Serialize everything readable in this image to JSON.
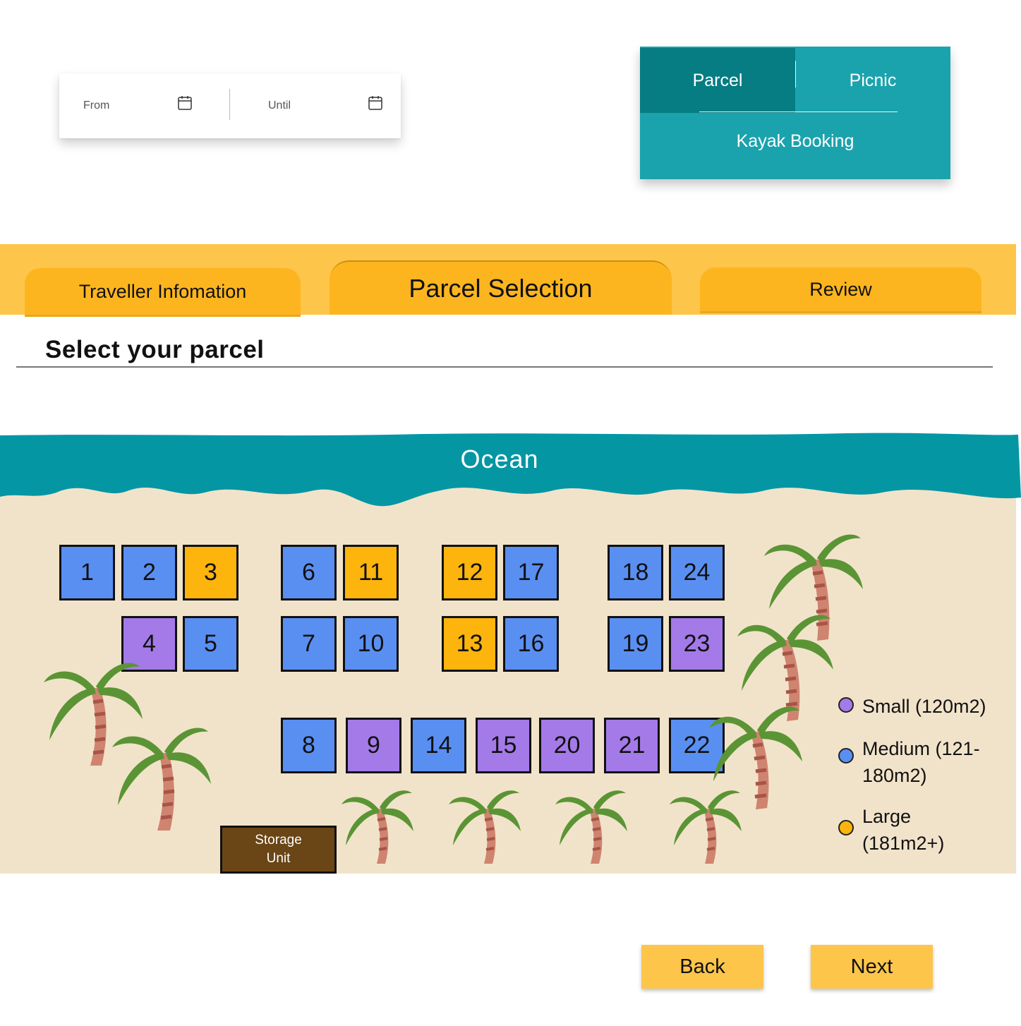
{
  "date_range": {
    "from_label": "From",
    "until_label": "Until"
  },
  "booking_types": {
    "parcel": "Parcel",
    "picnic": "Picnic",
    "kayak": "Kayak Booking",
    "active": "Parcel"
  },
  "steps": [
    "Traveller Infomation",
    "Parcel Selection",
    "Review"
  ],
  "active_step": "Parcel Selection",
  "section_title": "Select your parcel",
  "map": {
    "ocean_label": "Ocean",
    "storage_label_line1": "Storage",
    "storage_label_line2": "Unit",
    "parcels": [
      {
        "id": "1",
        "size": "medium"
      },
      {
        "id": "2",
        "size": "medium"
      },
      {
        "id": "3",
        "size": "large"
      },
      {
        "id": "4",
        "size": "small"
      },
      {
        "id": "5",
        "size": "medium"
      },
      {
        "id": "6",
        "size": "medium"
      },
      {
        "id": "11",
        "size": "large"
      },
      {
        "id": "7",
        "size": "medium"
      },
      {
        "id": "10",
        "size": "medium"
      },
      {
        "id": "12",
        "size": "large"
      },
      {
        "id": "17",
        "size": "medium"
      },
      {
        "id": "13",
        "size": "large"
      },
      {
        "id": "16",
        "size": "medium"
      },
      {
        "id": "18",
        "size": "medium"
      },
      {
        "id": "24",
        "size": "medium"
      },
      {
        "id": "19",
        "size": "medium"
      },
      {
        "id": "23",
        "size": "small"
      },
      {
        "id": "8",
        "size": "medium"
      },
      {
        "id": "9",
        "size": "small"
      },
      {
        "id": "14",
        "size": "medium"
      },
      {
        "id": "15",
        "size": "small"
      },
      {
        "id": "20",
        "size": "small"
      },
      {
        "id": "21",
        "size": "small"
      },
      {
        "id": "22",
        "size": "medium"
      }
    ]
  },
  "legend": [
    {
      "label": "Small (120m2)",
      "color": "#a47ae8"
    },
    {
      "label": "Medium (121-180m2)",
      "color": "#5a8ff2"
    },
    {
      "label": "Large (181m2+)",
      "color": "#fdb40c"
    }
  ],
  "colors": {
    "small": "#a47ae8",
    "medium": "#5a8ff2",
    "large": "#fdb40c",
    "ocean": "#0596a4",
    "sand": "#f1e3ca"
  },
  "buttons": {
    "back": "Back",
    "next": "Next"
  }
}
